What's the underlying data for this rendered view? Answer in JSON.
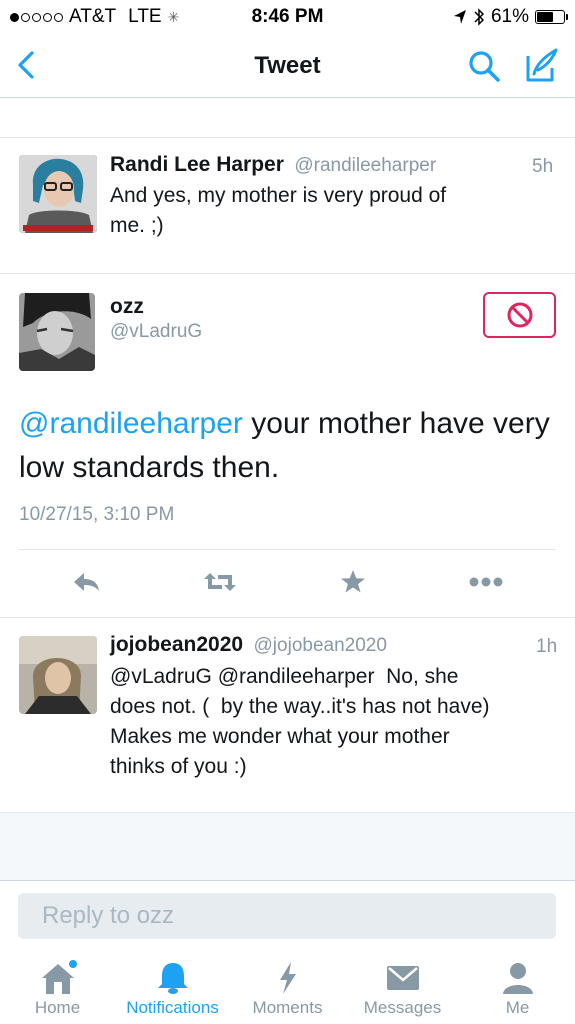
{
  "status_bar": {
    "carrier": "AT&T",
    "network": "LTE",
    "time": "8:46 PM",
    "battery_percent": "61%",
    "battery_level": 0.61,
    "signal_bars_filled": 1,
    "signal_bars_total": 5
  },
  "nav": {
    "title": "Tweet",
    "back_icon": "chevron-left-icon",
    "search_icon": "search-icon",
    "compose_icon": "compose-icon"
  },
  "tweets": [
    {
      "name": "Randi Lee Harper",
      "handle": "@randileeharper",
      "time_ago": "5h",
      "text_lines": [
        "And yes, my mother is very proud of",
        "me. ;)"
      ]
    },
    {
      "name": "ozz",
      "handle": "@vLadruG",
      "mention": "@randileeharper",
      "text_rest": " your mother have very low standards then.",
      "date": "10/27/15, 3:10 PM",
      "block_icon": "block-icon"
    },
    {
      "name": "jojobean2020",
      "handle": "@jojobean2020",
      "time_ago": "1h",
      "text_lines": [
        "@vLadruG @randileeharper  No, she",
        "does not. (  by the way..it's has not have)",
        "Makes me wonder what your mother",
        "thinks of you :)"
      ]
    }
  ],
  "actions": [
    "reply-icon",
    "retweet-icon",
    "like-icon",
    "more-icon"
  ],
  "reply": {
    "placeholder": "Reply to ozz"
  },
  "tabs": [
    {
      "label": "Home",
      "icon": "home-icon"
    },
    {
      "label": "Notifications",
      "icon": "bell-icon"
    },
    {
      "label": "Moments",
      "icon": "lightning-icon"
    },
    {
      "label": "Messages",
      "icon": "envelope-icon"
    },
    {
      "label": "Me",
      "icon": "person-icon"
    }
  ],
  "colors": {
    "accent": "#1da1f2",
    "block": "#e0245e",
    "text": "#14171a",
    "muted": "#8899a6"
  }
}
